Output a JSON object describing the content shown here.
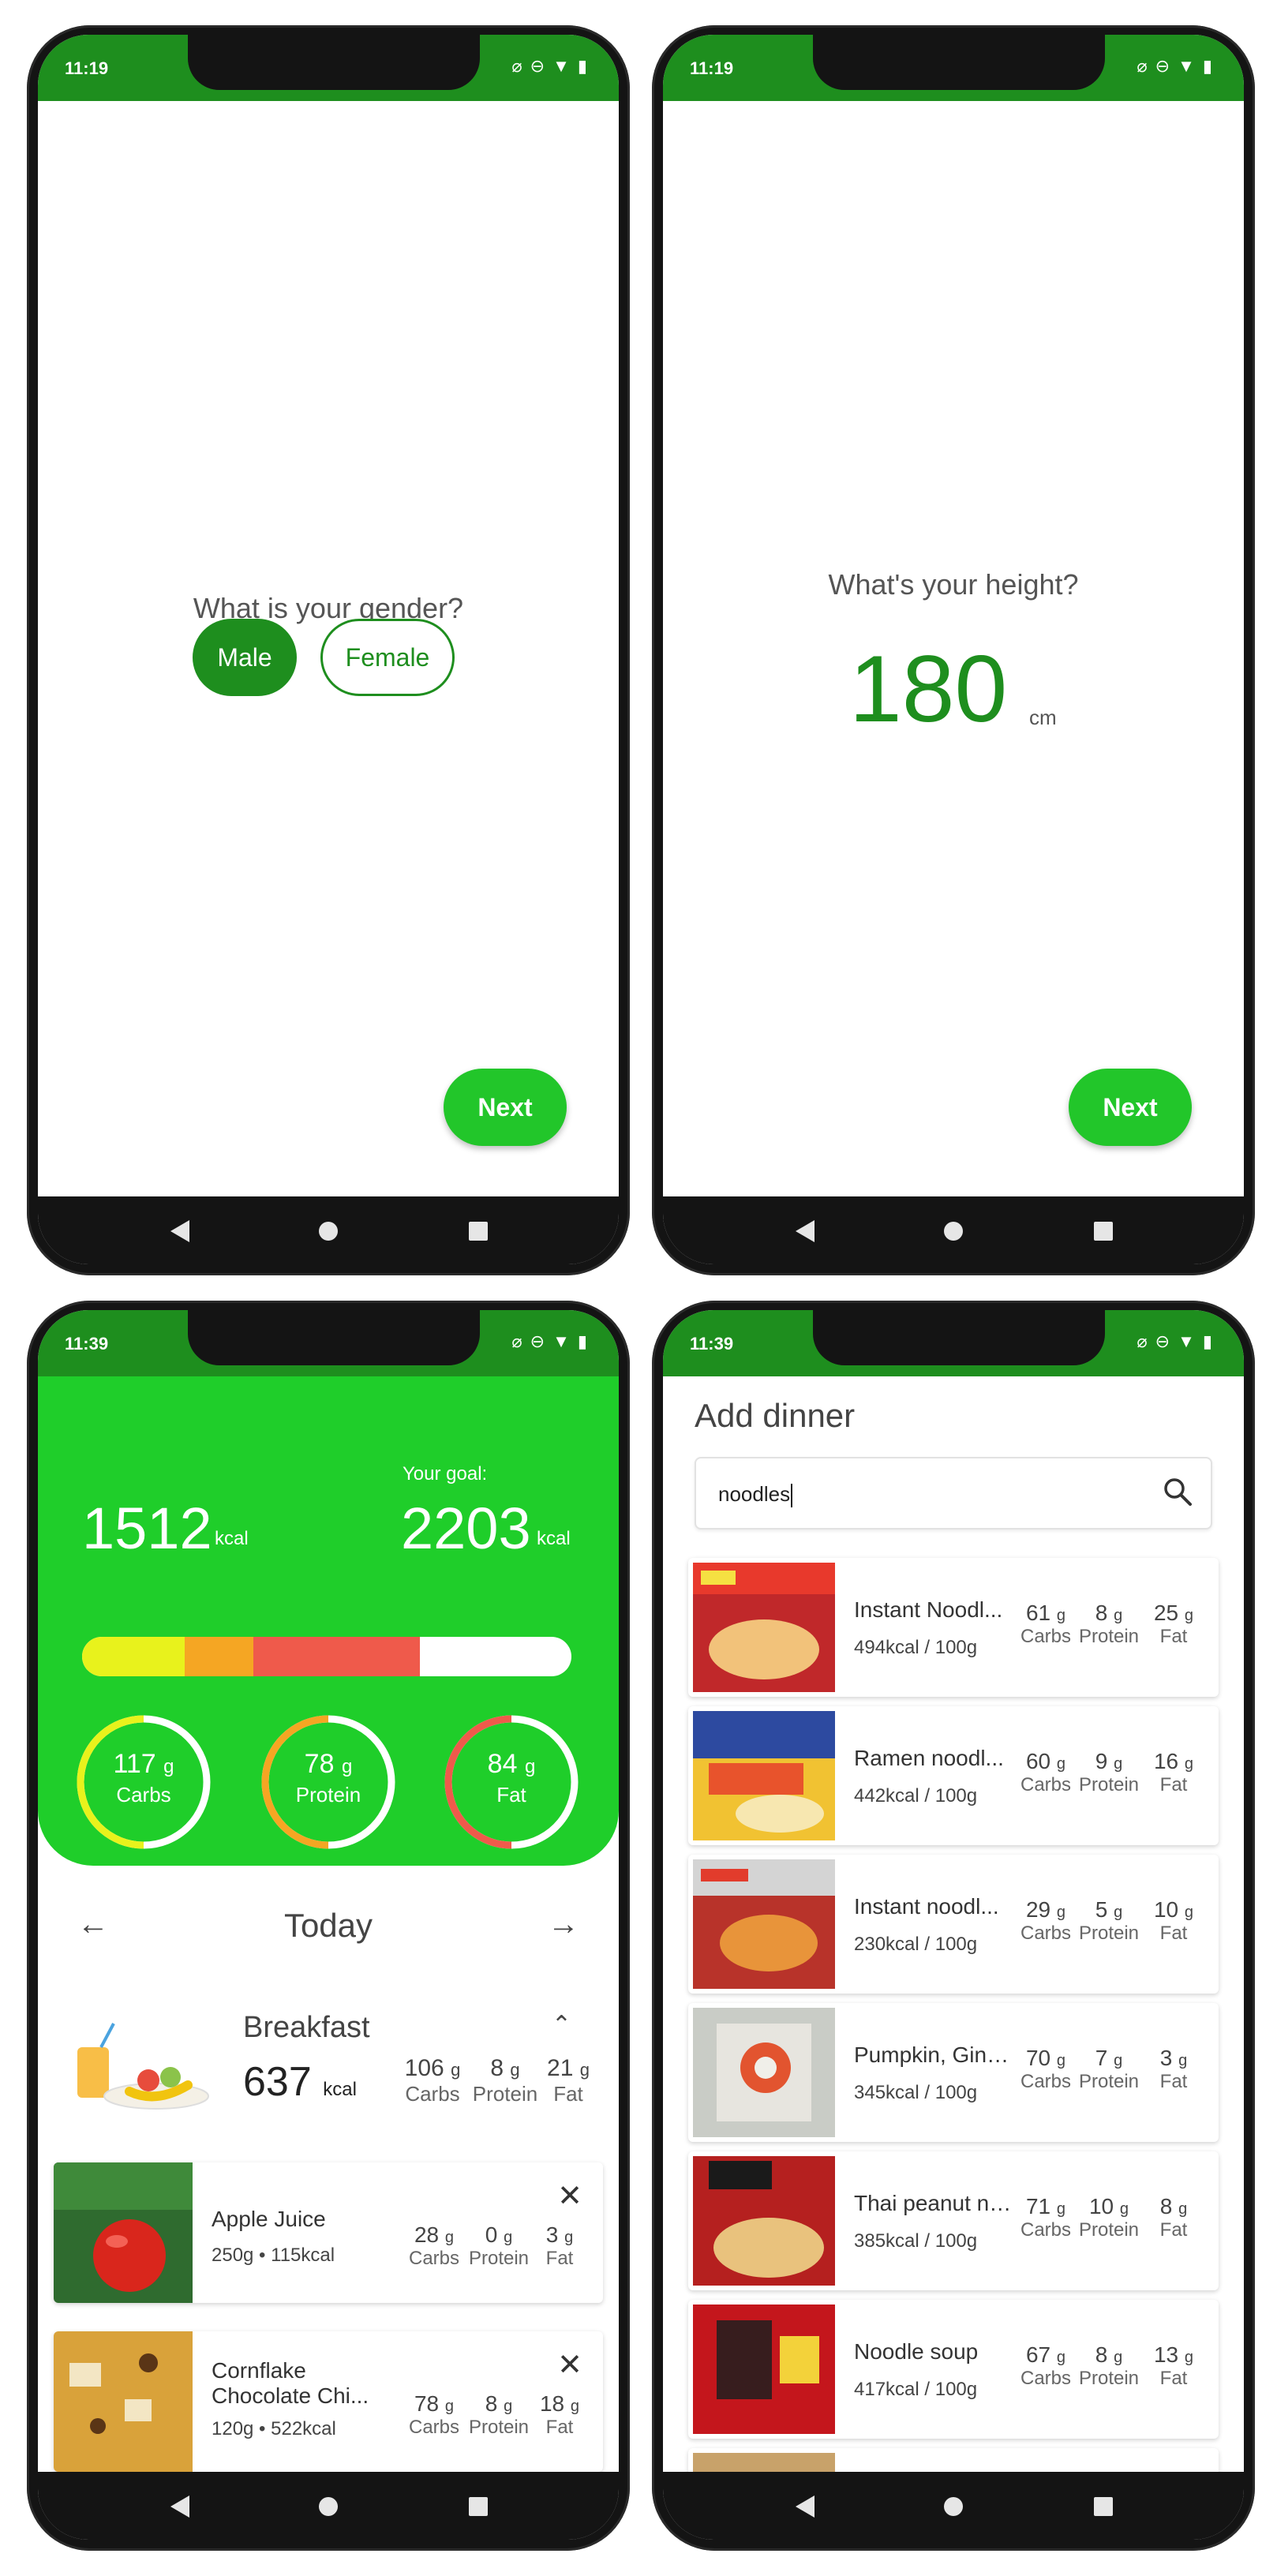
{
  "status": {
    "time_top": "11:19",
    "time_bottom": "11:39"
  },
  "screen_gender": {
    "question": "What is your gender?",
    "male_label": "Male",
    "female_label": "Female",
    "next_label": "Next"
  },
  "screen_height": {
    "question": "What's your height?",
    "value": "180",
    "unit": "cm",
    "next_label": "Next"
  },
  "screen_dashboard": {
    "consumed": "1512",
    "consumed_unit": "kcal",
    "goal_label": "Your goal:",
    "goal": "2203",
    "goal_unit": "kcal",
    "progress": {
      "carbs_fraction": 0.21,
      "protein_fraction": 0.14,
      "fat_fraction": 0.34
    },
    "macros": [
      {
        "value": "117",
        "unit": "g",
        "label": "Carbs",
        "color": "#e8f21c",
        "fraction": 0.5
      },
      {
        "value": "78",
        "unit": "g",
        "label": "Protein",
        "color": "#f5a623",
        "fraction": 0.5
      },
      {
        "value": "84",
        "unit": "g",
        "label": "Fat",
        "color": "#ef5a4b",
        "fraction": 0.5
      }
    ],
    "day_label": "Today",
    "meal": {
      "title": "Breakfast",
      "kcal": "637",
      "kcal_unit": "kcal",
      "carbs": "106",
      "protein": "8",
      "fat": "21",
      "unit": "g",
      "carbs_label": "Carbs",
      "protein_label": "Protein",
      "fat_label": "Fat"
    },
    "foods": [
      {
        "name": "Apple Juice",
        "sub": "250g • 115kcal",
        "carbs": "28",
        "protein": "0",
        "fat": "3"
      },
      {
        "name": "Cornflake",
        "name2": "Chocolate Chi...",
        "sub": "120g • 522kcal",
        "carbs": "78",
        "protein": "8",
        "fat": "18"
      }
    ]
  },
  "screen_search": {
    "title": "Add dinner",
    "query": "noodles",
    "results": [
      {
        "name": "Instant Noodl...",
        "sub": "494kcal / 100g",
        "carbs": "61",
        "protein": "8",
        "fat": "25"
      },
      {
        "name": "Ramen noodl...",
        "sub": "442kcal / 100g",
        "carbs": "60",
        "protein": "9",
        "fat": "16"
      },
      {
        "name": "Instant noodl...",
        "sub": "230kcal / 100g",
        "carbs": "29",
        "protein": "5",
        "fat": "10"
      },
      {
        "name": "Pumpkin, Ging...",
        "sub": "345kcal / 100g",
        "carbs": "70",
        "protein": "7",
        "fat": "3"
      },
      {
        "name": "Thai peanut no...",
        "sub": "385kcal / 100g",
        "carbs": "71",
        "protein": "10",
        "fat": "8"
      },
      {
        "name": "Noodle soup",
        "sub": "417kcal / 100g",
        "carbs": "67",
        "protein": "8",
        "fat": "13"
      }
    ]
  },
  "labels": {
    "g": "g",
    "carbs": "Carbs",
    "protein": "Protein",
    "fat": "Fat"
  },
  "colors": {
    "statusbar": "#1e8e1e",
    "accent": "#22c62a",
    "header": "#1fce2a",
    "carbs": "#e8f21c",
    "protein": "#f5a623",
    "fat": "#ef5a4b"
  }
}
